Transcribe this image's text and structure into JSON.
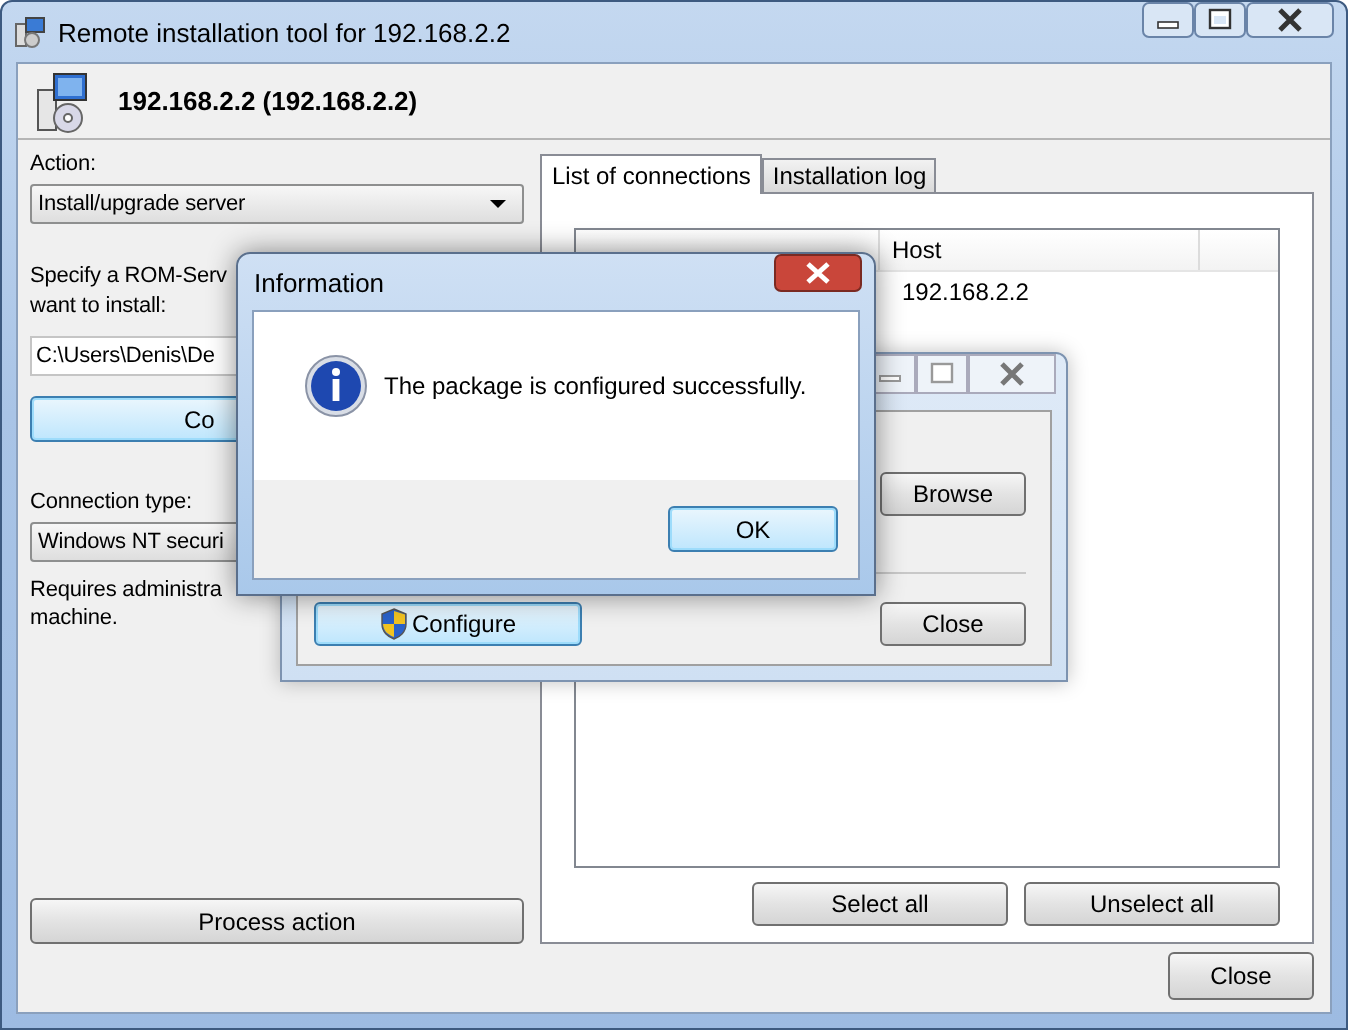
{
  "main_window": {
    "title": "Remote installation tool for 192.168.2.2",
    "header": "192.168.2.2 (192.168.2.2)",
    "action": {
      "label": "Action:",
      "value": "Install/upgrade server"
    },
    "rom_server": {
      "label_lines": [
        "Specify a ROM-Serv",
        "want to install:"
      ],
      "path": "C:\\Users\\Denis\\De",
      "configure_button": "Co"
    },
    "connection_type": {
      "label": "Connection type:",
      "value": "Windows NT securi"
    },
    "note_lines": [
      "Requires administra",
      "machine."
    ],
    "process_button": "Process action",
    "tabs": [
      {
        "label": "List of connections",
        "selected": true
      },
      {
        "label": "Installation log",
        "selected": false
      }
    ],
    "connections": {
      "columns": [
        "Host"
      ],
      "rows": [
        {
          "host": "192.168.2.2"
        }
      ]
    },
    "select_all_button": "Select all",
    "unselect_all_button": "Unselect all",
    "close_button": "Close"
  },
  "configure_window": {
    "browse_button": "Browse",
    "configure_button": "Configure",
    "close_button": "Close"
  },
  "info_dialog": {
    "title": "Information",
    "message": "The package is configured successfully.",
    "ok_button": "OK"
  }
}
